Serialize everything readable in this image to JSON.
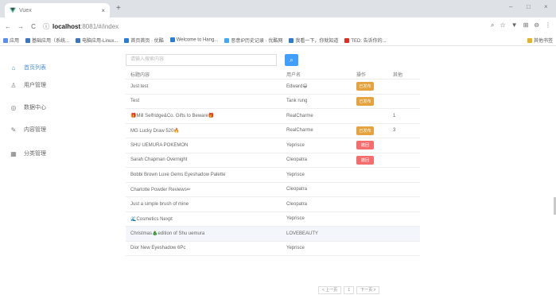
{
  "browser": {
    "tab_title": "Vuex",
    "tab_close": "×",
    "new_tab": "+",
    "url_host": "localhost",
    "url_path": ":8081/#/index",
    "controls": [
      "–",
      "□",
      "×"
    ],
    "bookmarks": [
      {
        "label": "应用",
        "color": "#5b8def"
      },
      {
        "label": "基础应用（系统...",
        "color": "#3a75c4"
      },
      {
        "label": "电脑应用-Linux...",
        "color": "#3a75c4"
      },
      {
        "label": "首页首页 · 优酷",
        "color": "#2b7cd3"
      },
      {
        "label": "Welcome to Hang...",
        "color": "#2b7cd3"
      },
      {
        "label": "恶意IP历史记录 · 优酷网",
        "color": "#3fa9f5"
      },
      {
        "label": "我看一下，你就知道",
        "color": "#2b7cd3"
      },
      {
        "label": "TED: 告诉你的...",
        "color": "#e62b1e"
      },
      {
        "label": "其他书签",
        "color": "#e8b11f"
      }
    ]
  },
  "sidebar": {
    "items": [
      {
        "icon": "⌂",
        "label": "首页列表",
        "active": true
      },
      {
        "icon": "♙",
        "label": "用户管理",
        "active": false
      },
      {
        "icon": "◎",
        "label": "数据中心",
        "active": false
      },
      {
        "icon": "✎",
        "label": "内容管理",
        "active": false
      },
      {
        "icon": "▦",
        "label": "分类管理",
        "active": false
      }
    ]
  },
  "search": {
    "placeholder": "请输入搜索内容",
    "button_icon": "⌕"
  },
  "table": {
    "headers": [
      "标题内容",
      "用户名",
      "操作",
      "其他"
    ],
    "rows": [
      {
        "title": "Just test",
        "user": "Edward😀",
        "action": "orange",
        "action_label": "已发布",
        "extra": ""
      },
      {
        "title": "Test",
        "user": "Tank rung",
        "action": "orange",
        "action_label": "已发布",
        "extra": ""
      },
      {
        "title": "🎁Mill Selfridge&Co. Gifts to Beware🎁",
        "user": "RealCharme",
        "action": "",
        "action_label": "",
        "extra": "1"
      },
      {
        "title": "MG Lucky Draw 520🔥",
        "user": "RealCharme",
        "action": "orange",
        "action_label": "已发布",
        "extra": "3"
      },
      {
        "title": "SHU UEMURA POKEMON",
        "user": "Yeprisce",
        "action": "red",
        "action_label": "撤回",
        "extra": ""
      },
      {
        "title": "Sarah Chapman Overnight",
        "user": "Cleopatra",
        "action": "red",
        "action_label": "撤回",
        "extra": ""
      },
      {
        "title": "Bobbi Brown Luxe Gems Eyeshadow Palette",
        "user": "Yeprisce",
        "action": "",
        "action_label": "",
        "extra": ""
      },
      {
        "title": "Charlotte Powder Reviews✏",
        "user": "Cleopatra",
        "action": "",
        "action_label": "",
        "extra": ""
      },
      {
        "title": "Just a simple brush of mine",
        "user": "Cleopatra",
        "action": "",
        "action_label": "",
        "extra": ""
      },
      {
        "title": "🌊Cosmetics Nexpt",
        "user": "Yeprisce",
        "action": "",
        "action_label": "",
        "extra": ""
      },
      {
        "title": "Christmas🎄edition of Shu uemura",
        "user": "LOVEBEAUTY",
        "action": "",
        "action_label": "",
        "extra": ""
      },
      {
        "title": "Dior New Eyeshadow 6Pc",
        "user": "Yeprisce",
        "action": "",
        "action_label": "",
        "extra": ""
      }
    ]
  },
  "pagination": {
    "prev": "< 上一页",
    "page": "1",
    "next": "下一页 >"
  }
}
